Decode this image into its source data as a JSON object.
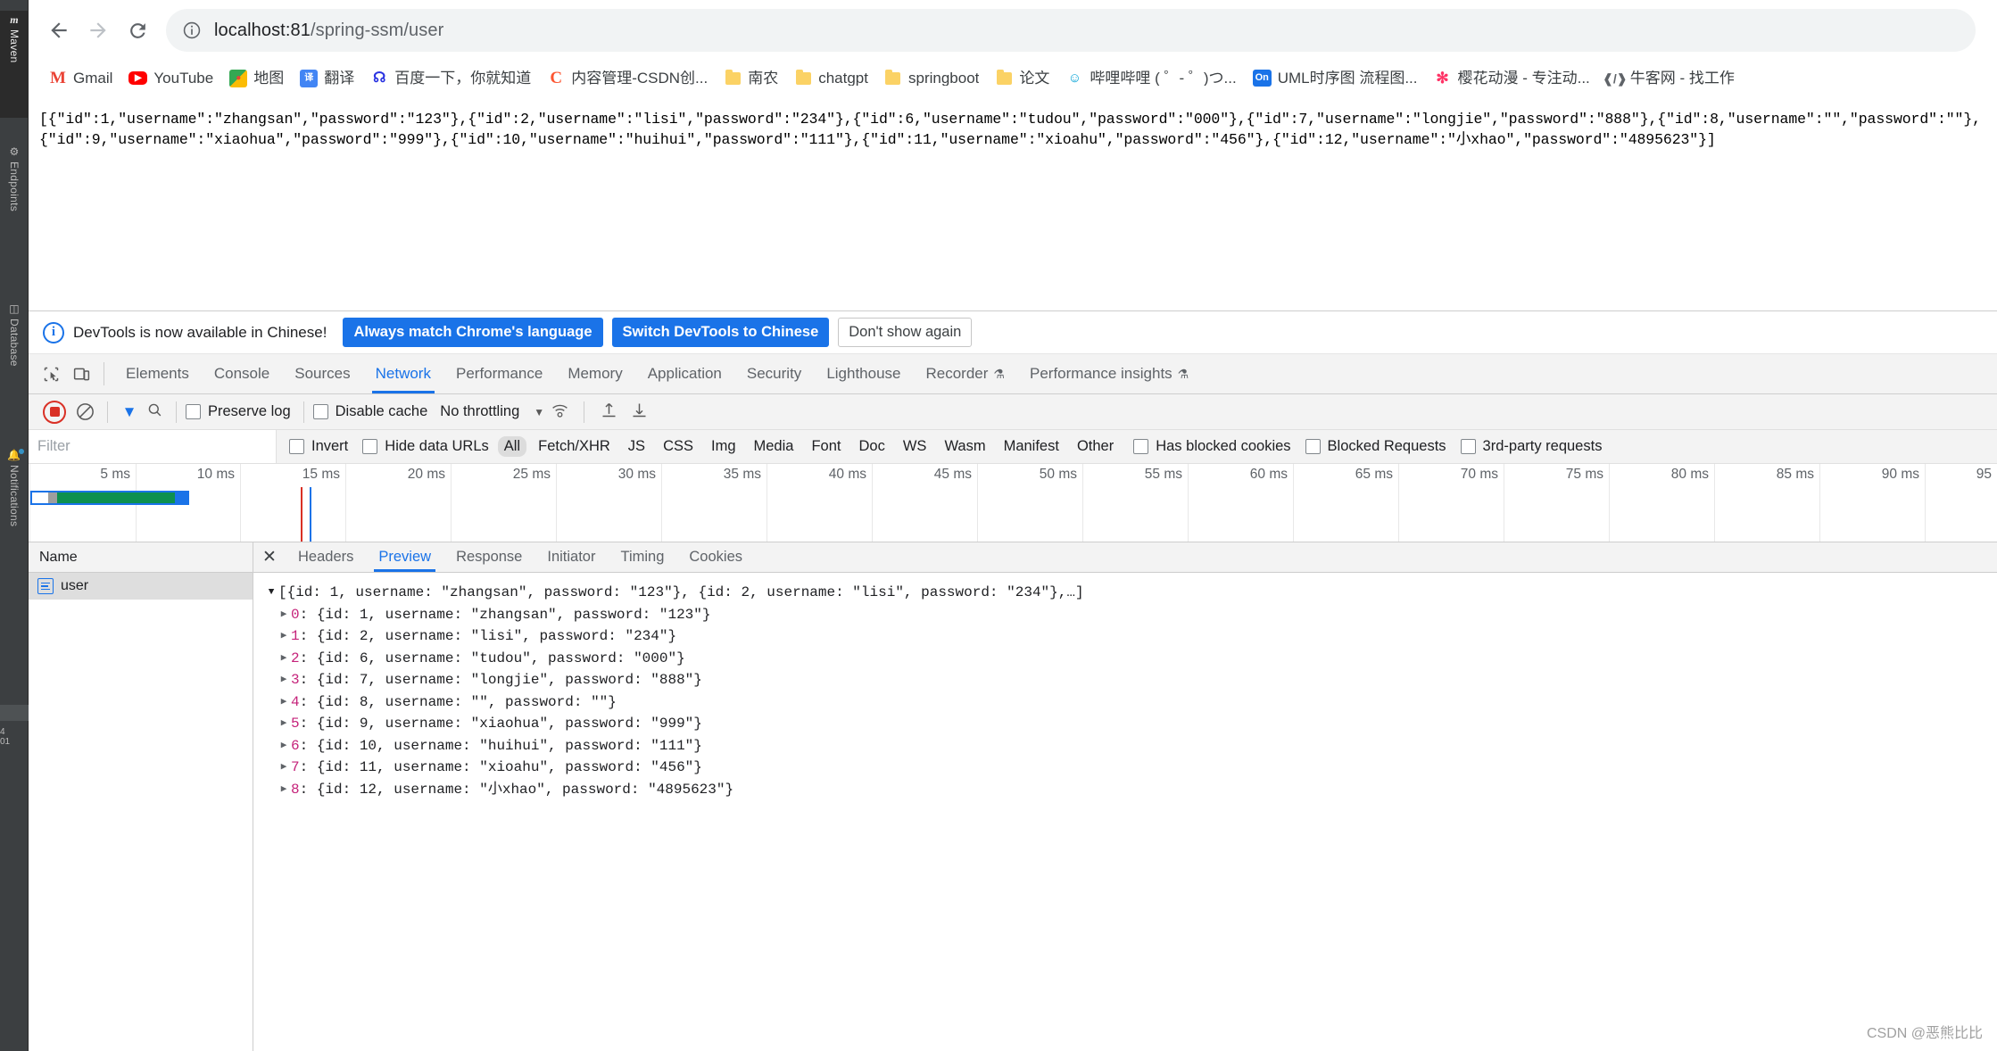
{
  "ide": {
    "rail_items": [
      {
        "label": "Maven",
        "icon": "maven-icon",
        "active": true
      },
      {
        "label": "Endpoints",
        "icon": "endpoints-icon",
        "active": false
      },
      {
        "label": "Database",
        "icon": "database-icon",
        "active": false
      },
      {
        "label": "Notifications",
        "icon": "notifications-icon",
        "active": false
      }
    ]
  },
  "browser": {
    "nav": {
      "back": "back-arrow",
      "forward": "forward-arrow",
      "reload": "reload-arrow"
    },
    "omnibox": {
      "site_info_icon": "info-circle-icon",
      "host": "localhost:81",
      "path": "/spring-ssm/user",
      "full_url": "localhost:81/spring-ssm/user"
    },
    "bookmarks": [
      {
        "label": "Gmail",
        "icon": "gmail-icon",
        "glyph": "M",
        "cls": "ico-gmail"
      },
      {
        "label": "YouTube",
        "icon": "youtube-icon",
        "glyph": "▶",
        "cls": "ico-yt"
      },
      {
        "label": "地图",
        "icon": "google-maps-icon",
        "glyph": "◆",
        "cls": "ico-maps"
      },
      {
        "label": "翻译",
        "icon": "google-translate-icon",
        "glyph": "译",
        "cls": "ico-trans"
      },
      {
        "label": "百度一下，你就知道",
        "icon": "baidu-icon",
        "glyph": "熊",
        "cls": "ico-baidu"
      },
      {
        "label": "内容管理-CSDN创...",
        "icon": "csdn-icon",
        "glyph": "C",
        "cls": "ico-csdn"
      },
      {
        "label": "南农",
        "icon": "folder-icon",
        "glyph": "",
        "cls": "ico-folder"
      },
      {
        "label": "chatgpt",
        "icon": "folder-icon",
        "glyph": "",
        "cls": "ico-folder"
      },
      {
        "label": "springboot",
        "icon": "folder-icon",
        "glyph": "",
        "cls": "ico-folder"
      },
      {
        "label": "论文",
        "icon": "folder-icon",
        "glyph": "",
        "cls": "ico-folder"
      },
      {
        "label": "哔哩哔哩 ( ゜- ゜)つ...",
        "icon": "bilibili-icon",
        "glyph": "□",
        "cls": "ico-bili"
      },
      {
        "label": "UML时序图 流程图...",
        "icon": "on-icon",
        "glyph": "On",
        "cls": "ico-on"
      },
      {
        "label": "樱花动漫 - 专注动...",
        "icon": "sakura-icon",
        "glyph": "✻",
        "cls": "ico-sakura"
      },
      {
        "label": "牛客网 - 找工作",
        "icon": "nowcoder-icon",
        "glyph": "«›",
        "cls": "ico-nowcoder"
      }
    ]
  },
  "page": {
    "raw_json": "[{\"id\":1,\"username\":\"zhangsan\",\"password\":\"123\"},{\"id\":2,\"username\":\"lisi\",\"password\":\"234\"},{\"id\":6,\"username\":\"tudou\",\"password\":\"000\"},{\"id\":7,\"username\":\"longjie\",\"password\":\"888\"},{\"id\":8,\"username\":\"\",\"password\":\"\"},{\"id\":9,\"username\":\"xiaohua\",\"password\":\"999\"},{\"id\":10,\"username\":\"huihui\",\"password\":\"111\"},{\"id\":11,\"username\":\"xioahu\",\"password\":\"456\"},{\"id\":12,\"username\":\"小xhao\",\"password\":\"4895623\"}]"
  },
  "devtools": {
    "banner": {
      "icon": "info-icon",
      "message": "DevTools is now available in Chinese!",
      "primary_btn_1": "Always match Chrome's language",
      "primary_btn_2": "Switch DevTools to Chinese",
      "dismiss_btn": "Don't show again"
    },
    "tabs": [
      {
        "label": "Elements",
        "active": false,
        "beaker": false
      },
      {
        "label": "Console",
        "active": false,
        "beaker": false
      },
      {
        "label": "Sources",
        "active": false,
        "beaker": false
      },
      {
        "label": "Network",
        "active": true,
        "beaker": false
      },
      {
        "label": "Performance",
        "active": false,
        "beaker": false
      },
      {
        "label": "Memory",
        "active": false,
        "beaker": false
      },
      {
        "label": "Application",
        "active": false,
        "beaker": false
      },
      {
        "label": "Security",
        "active": false,
        "beaker": false
      },
      {
        "label": "Lighthouse",
        "active": false,
        "beaker": false
      },
      {
        "label": "Recorder",
        "active": false,
        "beaker": true
      },
      {
        "label": "Performance insights",
        "active": false,
        "beaker": true
      }
    ],
    "toolbar": {
      "record_tooltip": "record",
      "clear_tooltip": "clear",
      "filter_tooltip": "filter",
      "search_tooltip": "search",
      "preserve_log": "Preserve log",
      "disable_cache": "Disable cache",
      "throttling": "No throttling",
      "import_tooltip": "import-har",
      "export_tooltip": "export-har"
    },
    "filter_bar": {
      "filter_placeholder": "Filter",
      "invert": "Invert",
      "hide_data_urls": "Hide data URLs",
      "types": [
        "All",
        "Fetch/XHR",
        "JS",
        "CSS",
        "Img",
        "Media",
        "Font",
        "Doc",
        "WS",
        "Wasm",
        "Manifest",
        "Other"
      ],
      "selected_type": "All",
      "has_blocked_cookies": "Has blocked cookies",
      "blocked_requests": "Blocked Requests",
      "third_party_requests": "3rd-party requests"
    },
    "overview": {
      "ticks": [
        "5 ms",
        "10 ms",
        "15 ms",
        "20 ms",
        "25 ms",
        "30 ms",
        "35 ms",
        "40 ms",
        "45 ms",
        "50 ms",
        "55 ms",
        "60 ms",
        "65 ms",
        "70 ms",
        "75 ms",
        "80 ms",
        "85 ms",
        "90 ms",
        "95"
      ],
      "dom_content_loaded_color": "#d93025",
      "load_color": "#1a73e8",
      "bar_colors": {
        "stalled": "#9e9e9e",
        "download": "#0d904f",
        "waiting": "#1a73e8"
      }
    },
    "request_list": {
      "column_header": "Name",
      "rows": [
        {
          "name": "user",
          "icon": "document-icon",
          "selected": true
        }
      ]
    },
    "detail_tabs": [
      {
        "label": "Headers",
        "active": false
      },
      {
        "label": "Preview",
        "active": true
      },
      {
        "label": "Response",
        "active": false
      },
      {
        "label": "Initiator",
        "active": false
      },
      {
        "label": "Timing",
        "active": false
      },
      {
        "label": "Cookies",
        "active": false
      }
    ],
    "preview": {
      "root": "[{id: 1, username: \"zhangsan\", password: \"123\"}, {id: 2, username: \"lisi\", password: \"234\"},…]",
      "items": [
        {
          "index": "0",
          "value": "{id: 1, username: \"zhangsan\", password: \"123\"}"
        },
        {
          "index": "1",
          "value": "{id: 2, username: \"lisi\", password: \"234\"}"
        },
        {
          "index": "2",
          "value": "{id: 6, username: \"tudou\", password: \"000\"}"
        },
        {
          "index": "3",
          "value": "{id: 7, username: \"longjie\", password: \"888\"}"
        },
        {
          "index": "4",
          "value": "{id: 8, username: \"\", password: \"\"}"
        },
        {
          "index": "5",
          "value": "{id: 9, username: \"xiaohua\", password: \"999\"}"
        },
        {
          "index": "6",
          "value": "{id: 10, username: \"huihui\", password: \"111\"}"
        },
        {
          "index": "7",
          "value": "{id: 11, username: \"xioahu\", password: \"456\"}"
        },
        {
          "index": "8",
          "value": "{id: 12, username: \"小xhao\", password: \"4895623\"}"
        }
      ]
    }
  },
  "watermark": "CSDN @恶熊比比"
}
